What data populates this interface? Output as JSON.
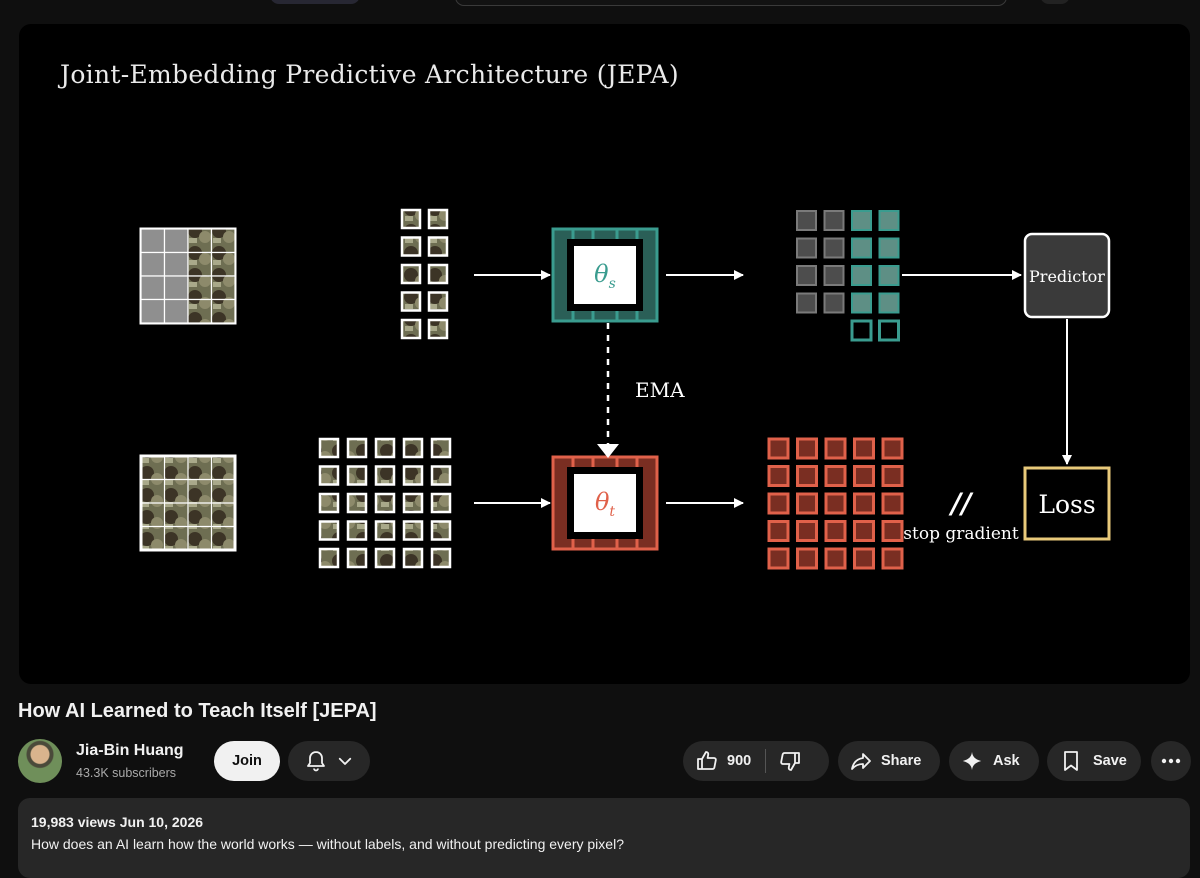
{
  "slide": {
    "title": "Joint-Embedding Predictive Architecture  (JEPA)",
    "student_encoder_symbol": "θ",
    "student_encoder_sub": "s",
    "teacher_encoder_symbol": "θ",
    "teacher_encoder_sub": "t",
    "ema_label": "EMA",
    "predictor_label": "Predictor",
    "loss_label": "Loss",
    "stop_gradient_label": "stop gradient",
    "stop_gradient_symbol": "//",
    "colors": {
      "student": "#3a9c8f",
      "teacher": "#e0614a",
      "loss_border": "#e8c97a"
    }
  },
  "video": {
    "title": "How AI Learned to Teach Itself [JEPA]",
    "channel_name": "Jia-Bin Huang",
    "subscribers": "43.3K subscribers",
    "join_label": "Join",
    "like_count": "900",
    "share_label": "Share",
    "ask_label": "Ask",
    "save_label": "Save"
  },
  "description": {
    "meta": "19,983 views  Jun 10, 2026",
    "text": "How does an AI learn how the world works — without labels, and without predicting every pixel?"
  },
  "icons": [
    "bell-icon",
    "chevron-down-icon",
    "thumbs-up-icon",
    "thumbs-down-icon",
    "share-icon",
    "sparkle-icon",
    "bookmark-icon",
    "more-icon"
  ]
}
